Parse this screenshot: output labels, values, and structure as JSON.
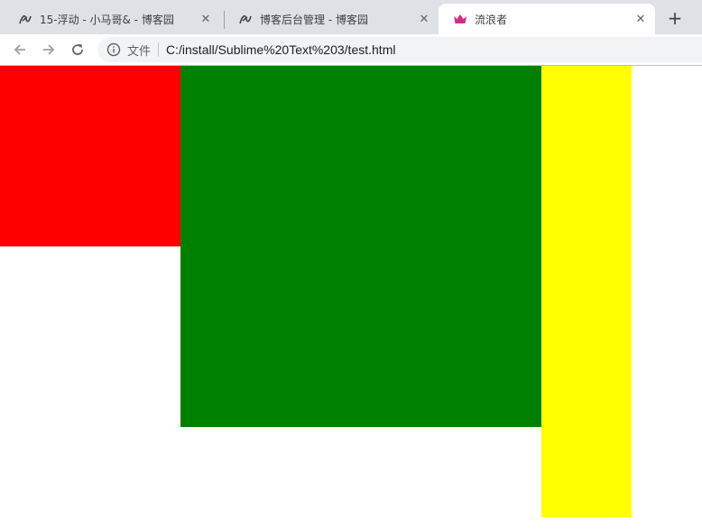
{
  "browser": {
    "tabs": [
      {
        "title": "15-浮动 - 小马哥& - 博客园",
        "icon": "cnblogs-icon"
      },
      {
        "title": "博客后台管理 - 博客园",
        "icon": "cnblogs-icon"
      },
      {
        "title": "流浪者",
        "icon": "crown-icon",
        "active": true
      }
    ],
    "new_tab_icon": "plus-icon",
    "close_icon": "close-icon",
    "address_bar": {
      "info_icon": "info-icon",
      "scheme_label": "文件",
      "url": "C:/install/Sublime%20Text%203/test.html"
    },
    "nav_icons": [
      "back-arrow-icon",
      "forward-arrow-icon",
      "reload-icon"
    ]
  },
  "page": {
    "boxes": [
      {
        "name": "red-box",
        "color": "#ff0000"
      },
      {
        "name": "green-box",
        "color": "#008000"
      },
      {
        "name": "yellow-box",
        "color": "#ffff00"
      }
    ]
  },
  "colors": {
    "tabstrip": "#dee1e6",
    "crown": "#d62b86"
  }
}
